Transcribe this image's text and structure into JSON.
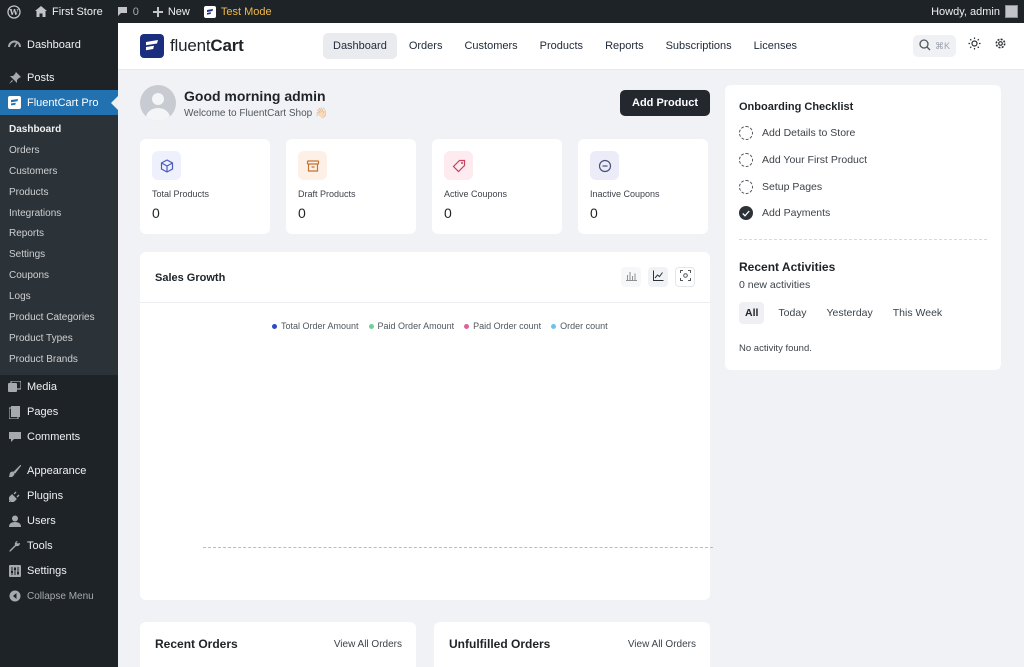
{
  "admin_bar": {
    "site_name": "First Store",
    "comments_count": "0",
    "new_label": "New",
    "test_mode_label": "Test Mode",
    "greeting": "Howdy, admin"
  },
  "wp_menu": {
    "dashboard": "Dashboard",
    "posts": "Posts",
    "fluentcart": "FluentCart Pro",
    "submenu": [
      "Dashboard",
      "Orders",
      "Customers",
      "Products",
      "Integrations",
      "Reports",
      "Settings",
      "Coupons",
      "Logs",
      "Product Categories",
      "Product Types",
      "Product Brands"
    ],
    "media": "Media",
    "pages": "Pages",
    "comments": "Comments",
    "appearance": "Appearance",
    "plugins": "Plugins",
    "users": "Users",
    "tools": "Tools",
    "settings": "Settings",
    "collapse": "Collapse Menu"
  },
  "fc_header": {
    "logo_light": "fluent",
    "logo_bold": "Cart",
    "tabs": [
      "Dashboard",
      "Orders",
      "Customers",
      "Products",
      "Reports",
      "Subscriptions",
      "Licenses"
    ],
    "active_tab": "Dashboard",
    "search_shortcut": "⌘K"
  },
  "greeting": {
    "title": "Good morning admin",
    "subtitle": "Welcome to FluentCart Shop 👋🏻"
  },
  "add_product_label": "Add Product",
  "stats": [
    {
      "label": "Total Products",
      "value": "0",
      "icon": "box-icon",
      "bg": "#eef0fb",
      "fg": "#4a5bbf"
    },
    {
      "label": "Draft Products",
      "value": "0",
      "icon": "archive-icon",
      "bg": "#fdf1e7",
      "fg": "#c7712f"
    },
    {
      "label": "Active Coupons",
      "value": "0",
      "icon": "tag-icon",
      "bg": "#fdebef",
      "fg": "#c7405d"
    },
    {
      "label": "Inactive Coupons",
      "value": "0",
      "icon": "minus-circle-icon",
      "bg": "#ecebf8",
      "fg": "#4a4f7a"
    }
  ],
  "sales_growth": {
    "title": "Sales Growth",
    "legend": [
      {
        "label": "Total Order Amount",
        "color": "#2d4bc4"
      },
      {
        "label": "Paid Order Amount",
        "color": "#6fcf9a"
      },
      {
        "label": "Paid Order count",
        "color": "#e0609a"
      },
      {
        "label": "Order count",
        "color": "#6cc3f0"
      }
    ]
  },
  "recent_orders": {
    "title": "Recent Orders",
    "link": "View All Orders"
  },
  "unfulfilled_orders": {
    "title": "Unfulfilled Orders",
    "link": "View All Orders"
  },
  "onboarding": {
    "title": "Onboarding Checklist",
    "items": [
      {
        "label": "Add Details to Store",
        "done": false
      },
      {
        "label": "Add Your First Product",
        "done": false
      },
      {
        "label": "Setup Pages",
        "done": false
      },
      {
        "label": "Add Payments",
        "done": true
      }
    ]
  },
  "recent_activities": {
    "title": "Recent Activities",
    "subtitle": "0 new activities",
    "tabs": [
      "All",
      "Today",
      "Yesterday",
      "This Week"
    ],
    "active_tab": "All",
    "empty": "No activity found."
  }
}
